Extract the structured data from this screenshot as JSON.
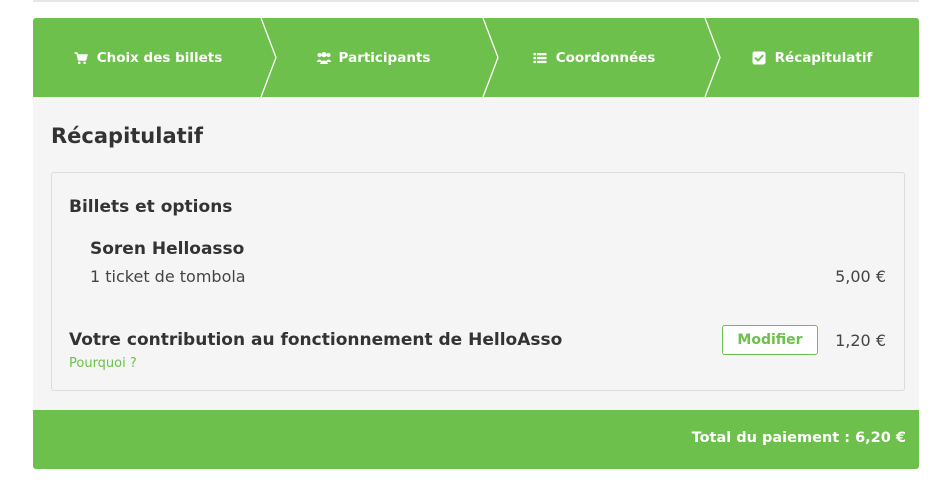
{
  "steps": [
    {
      "label": "Choix des billets",
      "icon": "cart-icon"
    },
    {
      "label": "Participants",
      "icon": "users-icon"
    },
    {
      "label": "Coordonnées",
      "icon": "list-icon"
    },
    {
      "label": "Récapitulatif",
      "icon": "check-square-icon"
    }
  ],
  "colors": {
    "accent": "#6dc04b",
    "panel": "#f5f5f5",
    "text": "#333333"
  },
  "page": {
    "title": "Récapitulatif"
  },
  "summary": {
    "title": "Billets et options",
    "participant": "Soren Helloasso",
    "ticket_label": "1 ticket de tombola",
    "ticket_price": "5,00 €",
    "contribution_label": "Votre contribution au fonctionnement de HelloAsso",
    "why_link": "Pourquoi ?",
    "modify_label": "Modifier",
    "contribution_price": "1,20 €"
  },
  "total": {
    "label": "Total du paiement : 6,20 €"
  }
}
